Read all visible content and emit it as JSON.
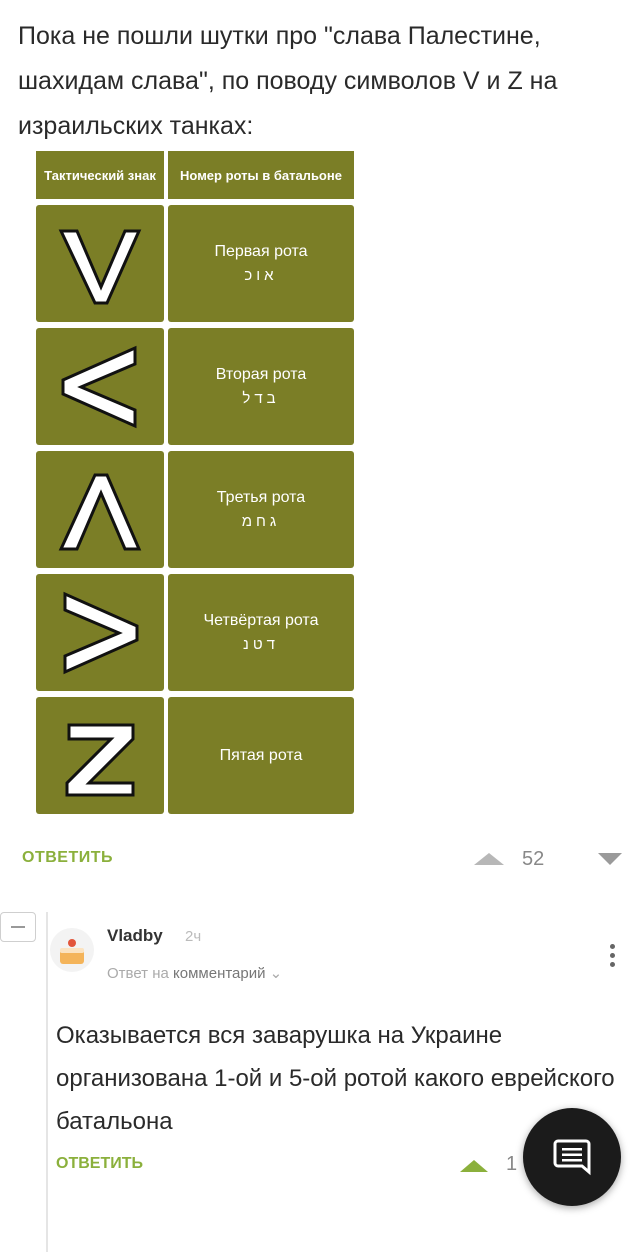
{
  "post": {
    "text": "Пока не пошли шутки про \"слава Палестине, шахидам слава\", по поводу символов V и Z на израильских танках:"
  },
  "table": {
    "header_symbol": "Тактический знак",
    "header_company": "Номер роты в батальоне",
    "rows": [
      {
        "symbol": "V",
        "name": "Первая рота",
        "hebrew": "אוכ"
      },
      {
        "symbol": "<",
        "name": "Вторая рота",
        "hebrew": "בדל"
      },
      {
        "symbol": "Λ",
        "name": "Третья рота",
        "hebrew": "גחמ"
      },
      {
        "symbol": ">",
        "name": "Четвёртая рота",
        "hebrew": "דטנ"
      },
      {
        "symbol": "Z",
        "name": "Пятая рота",
        "hebrew": ""
      }
    ]
  },
  "reply_bar": {
    "reply_label": "ОТВЕТИТЬ",
    "votes": "52"
  },
  "comment": {
    "author": "Vladby",
    "time": "2ч",
    "reply_to_prefix": "Ответ на",
    "reply_to_target": "комментарий",
    "text": "Оказывается вся заварушка на Украине организована 1-ой и 5-ой ротой какого еврейского батальона",
    "reply_label": "ОТВЕТИТЬ",
    "votes": "1"
  },
  "colors": {
    "olive": "#7b7e26",
    "accent_green": "#8bb03c"
  },
  "icons": [
    "upvote-icon",
    "downvote-icon",
    "collapse-icon",
    "more-vertical-icon",
    "chat-icon",
    "avatar-cake-icon"
  ]
}
